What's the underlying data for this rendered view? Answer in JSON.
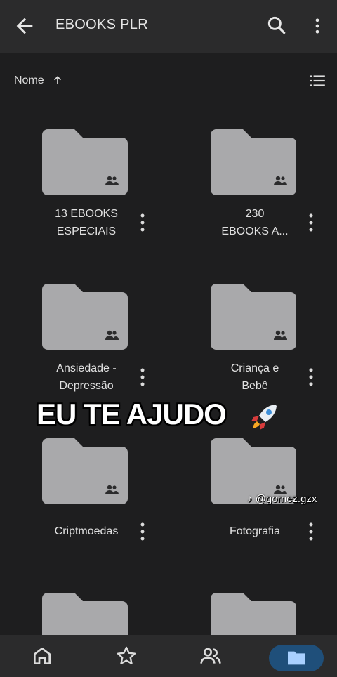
{
  "appbar": {
    "title": "EBOOKS PLR"
  },
  "sortbar": {
    "label": "Nome"
  },
  "folders": [
    {
      "name_line1": "13 EBOOKS",
      "name_line2": "ESPECIAIS",
      "shared": true
    },
    {
      "name_line1": "230",
      "name_line2": "EBOOKS A...",
      "shared": true
    },
    {
      "name_line1": "Ansiedade -",
      "name_line2": "Depressão",
      "shared": true
    },
    {
      "name_line1": "Criança e",
      "name_line2": "Bebê",
      "shared": true
    },
    {
      "name_line1": "Criptmoedas",
      "name_line2": "",
      "shared": true
    },
    {
      "name_line1": "Fotografia",
      "name_line2": "",
      "shared": true
    },
    {
      "name_line1": "",
      "name_line2": "",
      "shared": true
    },
    {
      "name_line1": "",
      "name_line2": "",
      "shared": true
    }
  ],
  "overlay": {
    "caption": "EU TE AJUDO",
    "watermark": "@gomez.gzx"
  },
  "bottomnav": {
    "items": [
      "home-icon",
      "star-icon",
      "people-icon",
      "folder-icon"
    ],
    "active": "folder-icon"
  },
  "colors": {
    "background": "#1e1e1f",
    "bar": "#2b2b2c",
    "folder": "#a9a9ab",
    "active_pill": "#1f4f7a"
  }
}
